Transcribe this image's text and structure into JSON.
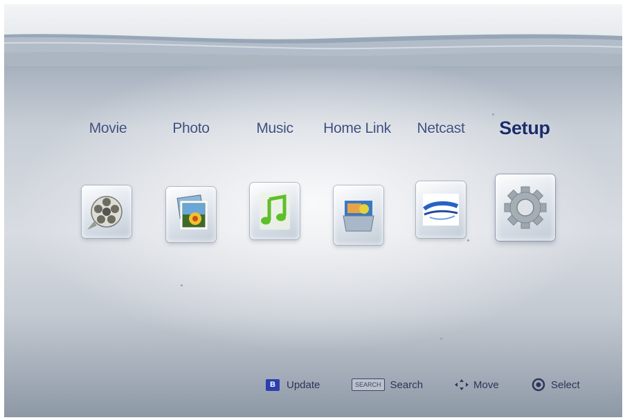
{
  "menu": {
    "items": [
      {
        "label": "Movie",
        "icon": "film-reel-icon",
        "active": false
      },
      {
        "label": "Photo",
        "icon": "photo-icon",
        "active": false
      },
      {
        "label": "Music",
        "icon": "music-note-icon",
        "active": false
      },
      {
        "label": "Home Link",
        "icon": "home-link-folder-icon",
        "active": false
      },
      {
        "label": "Netcast",
        "icon": "netcast-icon",
        "active": false
      },
      {
        "label": "Setup",
        "icon": "gear-icon",
        "active": true
      }
    ]
  },
  "hints": {
    "update_key": "B",
    "update_label": "Update",
    "search_key": "SEARCH",
    "search_label": "Search",
    "move_label": "Move",
    "select_label": "Select"
  },
  "colors": {
    "label": "#3f4f7e",
    "active_label": "#1c2c6b",
    "update_key_bg": "#2b3fae"
  }
}
